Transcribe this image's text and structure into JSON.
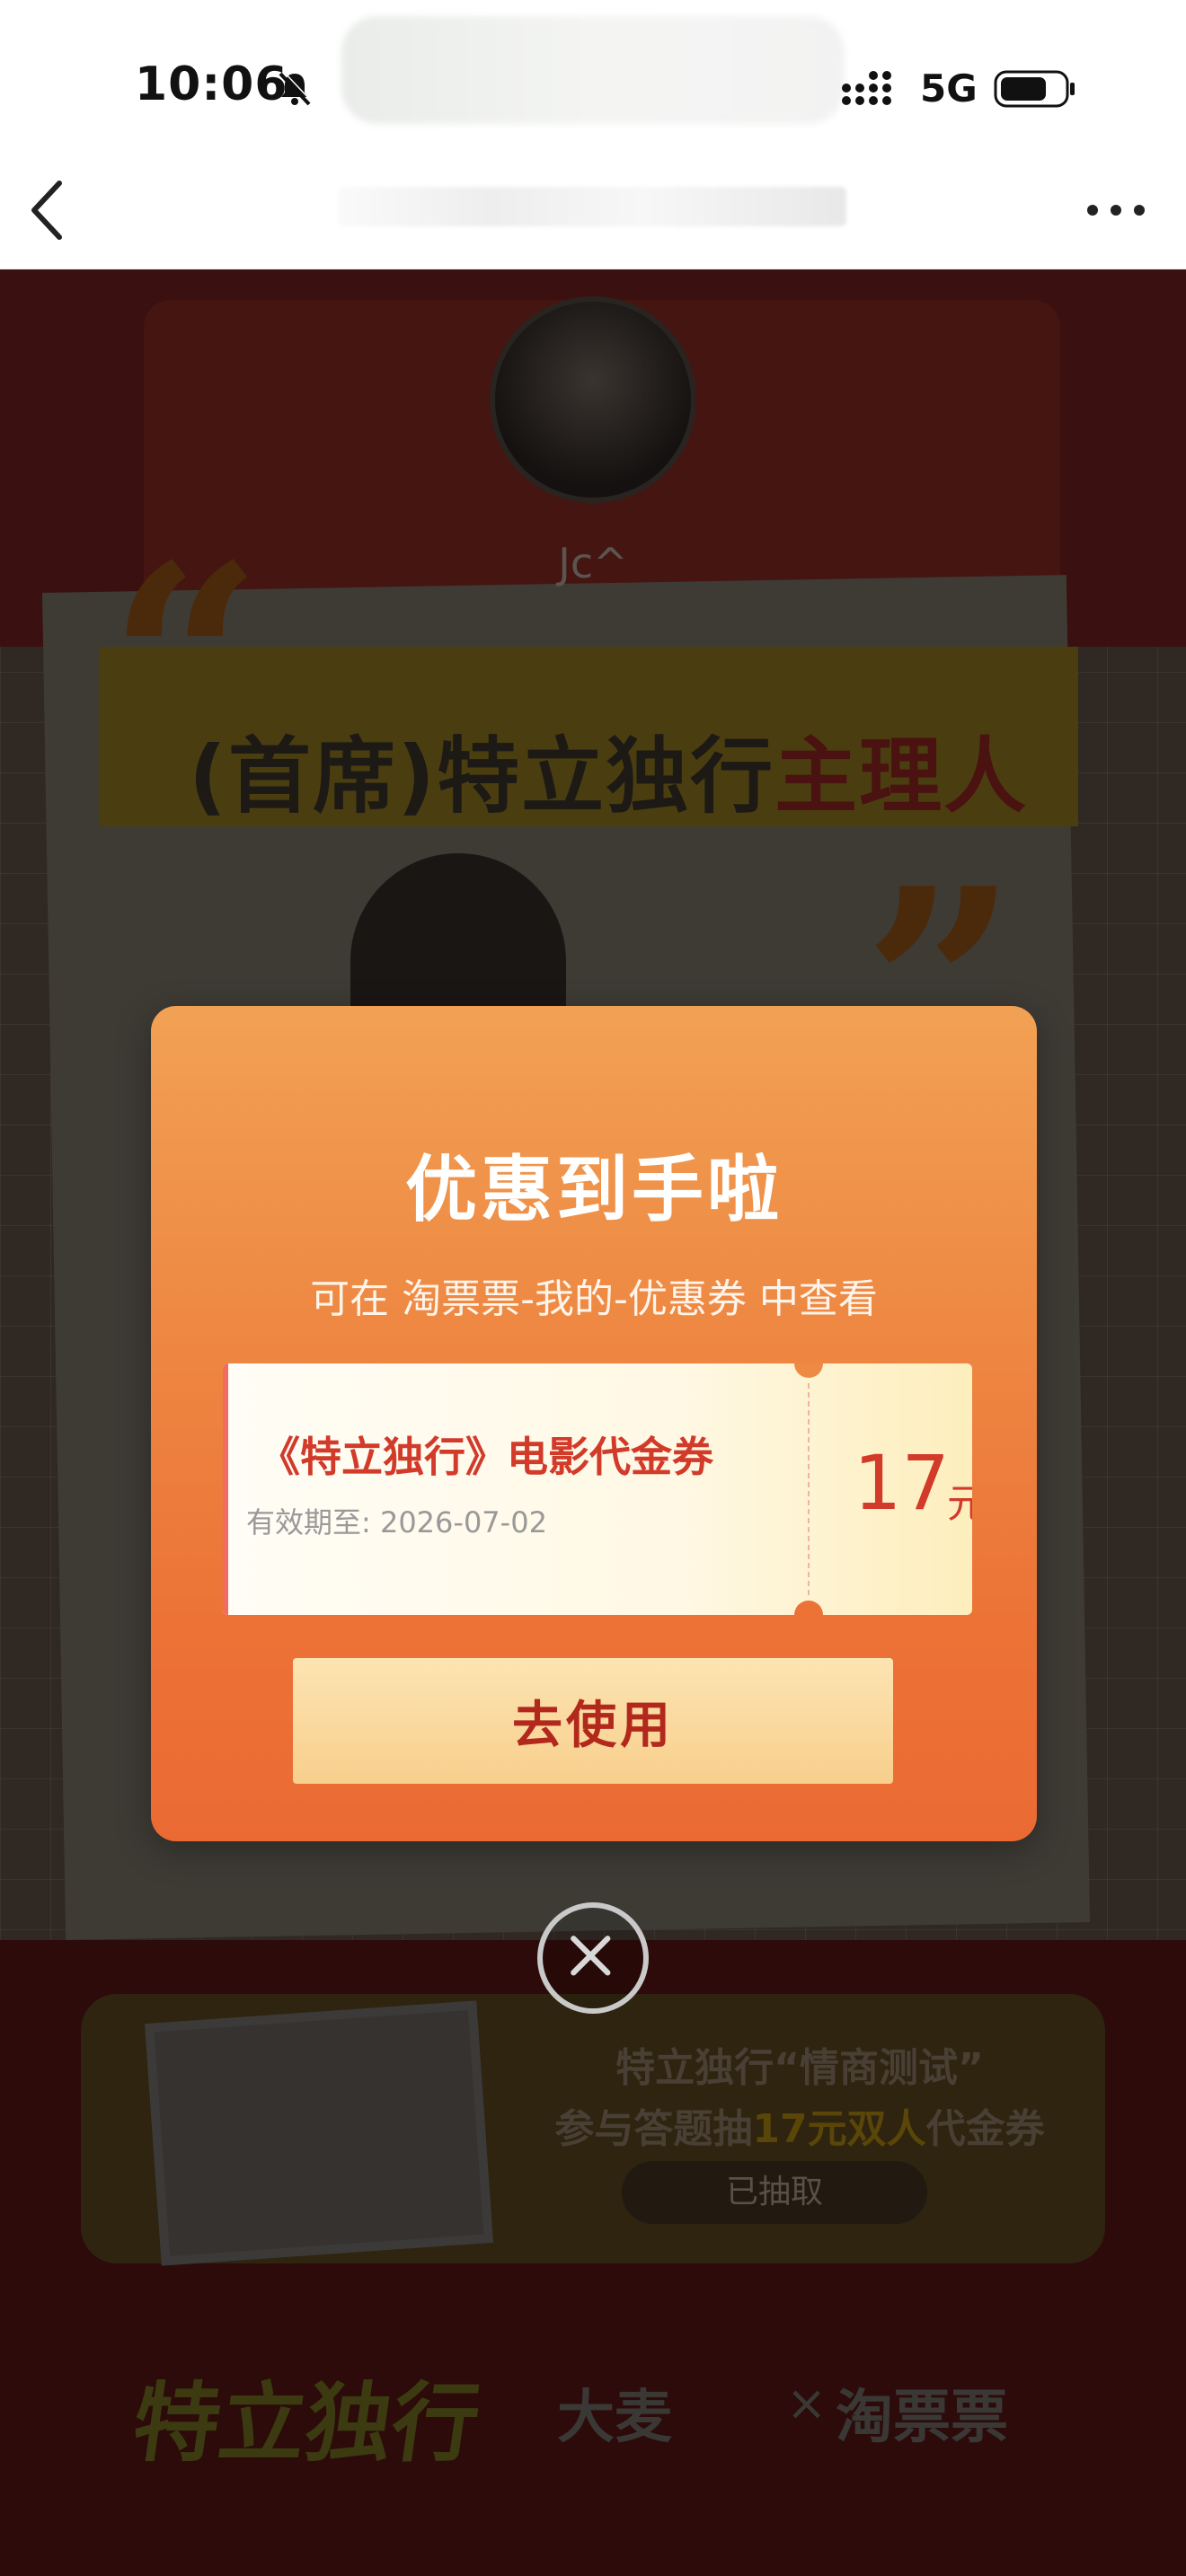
{
  "status_bar": {
    "time": "10:06",
    "network": "5G"
  },
  "background": {
    "username": "Jc^",
    "headline_prefix": "(首席)特立独行",
    "headline_accent": "主理人",
    "promo_title": "特立独行“情商测试”",
    "promo_subtitle_prefix": "参与答题抽",
    "promo_subtitle_highlight": "17元双人",
    "promo_subtitle_suffix": "代金券",
    "promo_button": "已抽取",
    "footer_logo": "特立独行",
    "footer_brand_1": "大麦",
    "footer_sep": "×",
    "footer_brand_2": "淘票票"
  },
  "modal": {
    "title": "优惠到手啦",
    "subtitle": "可在 淘票票-我的-优惠券 中查看",
    "coupon": {
      "name": "《特立独行》电影代金券",
      "expiry": "有效期至: 2026-07-02",
      "amount": "17",
      "unit": "元"
    },
    "use_button": "去使用"
  },
  "colors": {
    "accent": "#ec7236",
    "coupon_text": "#d23a2a",
    "button": "#f8cf8c"
  }
}
